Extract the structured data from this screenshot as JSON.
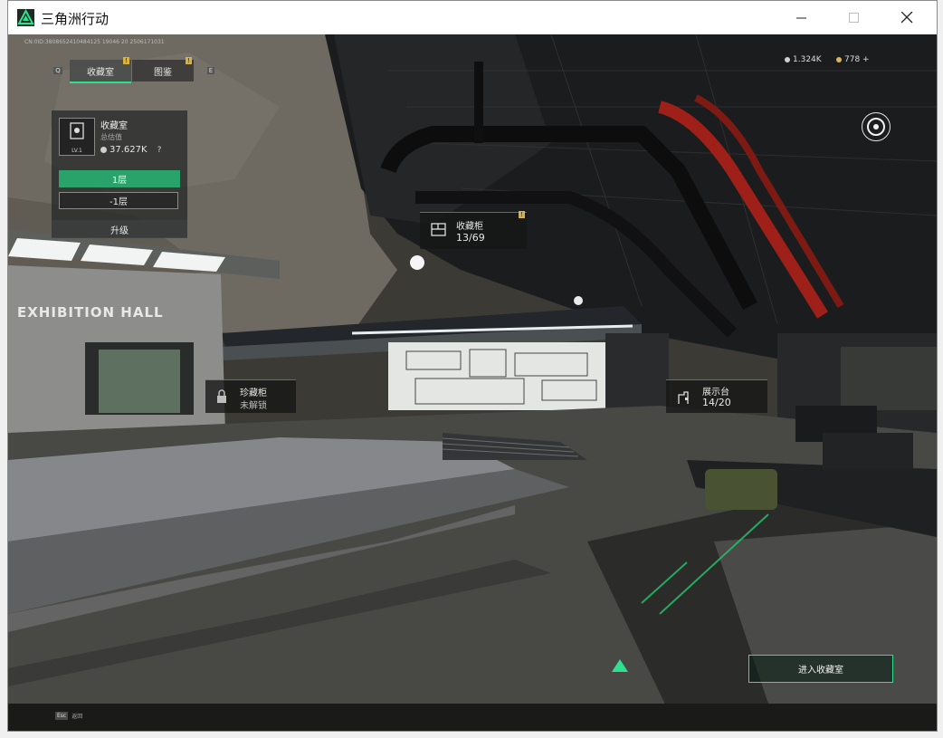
{
  "window": {
    "title": "三角洲行动"
  },
  "hud": {
    "build_info": "CN:0ID:3808652410484125 19046 20 2506171031",
    "currency": [
      {
        "icon": "coin-icon",
        "value": "1.324K"
      },
      {
        "icon": "gem-icon",
        "value": "778 +"
      }
    ]
  },
  "tabs": [
    {
      "left_key": "Q",
      "label": "收藏室",
      "active": true
    },
    {
      "label": "图鉴",
      "right_key": "E"
    }
  ],
  "collection_panel": {
    "title": "收藏室",
    "level": "LV.1",
    "value_label": "总估值",
    "value": "37.627K",
    "help": "?",
    "floors": [
      "1层",
      "-1层"
    ],
    "upgrade": "升级"
  },
  "labels": {
    "cabinet": {
      "title": "收藏柜",
      "count": "13/69"
    },
    "treasure": {
      "title": "珍藏柜",
      "status": "未解锁"
    },
    "display": {
      "title": "展示台",
      "count": "14/20"
    }
  },
  "enter_button": "进入收藏室",
  "footer": {
    "key": "Esc",
    "label": "返回"
  },
  "scene_text": {
    "exhibition_hall": "EXHIBITION HALL"
  },
  "colors": {
    "accent": "#2fe08d",
    "badge": "#d7b23e"
  }
}
